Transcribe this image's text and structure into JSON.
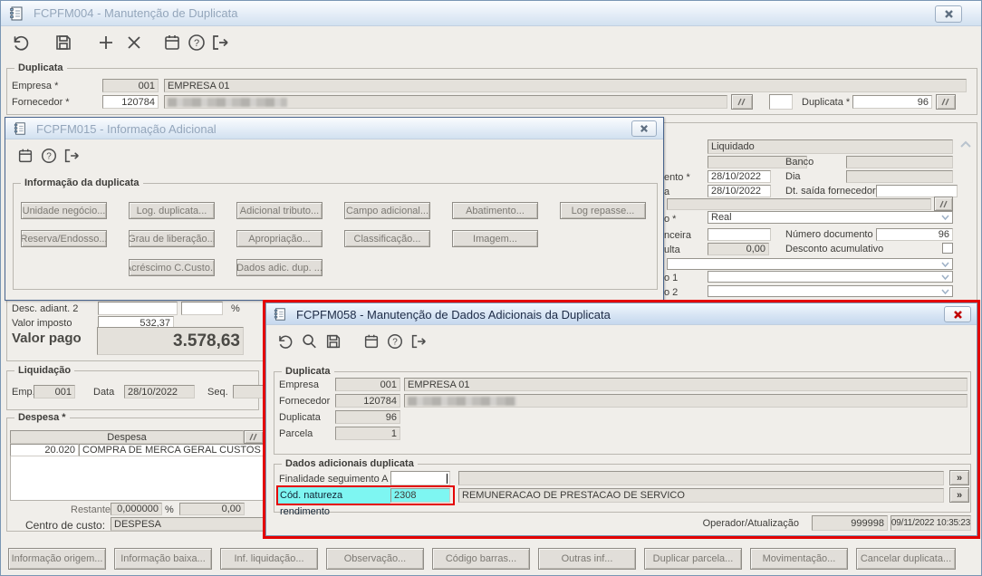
{
  "colors": {
    "highlight_red": "#e40000",
    "highlight_cyan": "#7ef6f2",
    "active_title_text": "#1d2b46",
    "inactive_title_text": "#94a6bb"
  },
  "fcpfm004": {
    "title": "FCPFM004 - Manutenção de Duplicata",
    "toolbar_icons": [
      "undo",
      "save",
      "add",
      "delete",
      "calendar",
      "help",
      "exit"
    ],
    "duplicata_group": {
      "label": "Duplicata",
      "empresa_label": "Empresa *",
      "empresa_code": "001",
      "empresa_name": "EMPRESA 01",
      "fornecedor_label": "Fornecedor *",
      "fornecedor_code": "120784",
      "duplicata_label": "Duplicata *",
      "duplicata_value": "96"
    },
    "right_fields": {
      "liquidado": "Liquidado",
      "banco_label": "Banco",
      "dia_label": "Dia",
      "vencimento_fragment": "ento *",
      "vencimento_value": "28/10/2022",
      "data_fragment": "a",
      "data_value": "28/10/2022",
      "dt_saida_label": "Dt. saída fornecedor",
      "moeda_fragment": "o *",
      "moeda_value": "Real",
      "financeira_fragment": "nceira",
      "numero_documento_label": "Número documento",
      "numero_documento_value": "96",
      "multa_fragment": "ulta",
      "multa_value": "0,00",
      "desconto_label": "Desconto acumulativo",
      "tipo1_fragment": "o 1",
      "tipo2_fragment": "o 2"
    },
    "valores": {
      "desc_adiant2_label": "Desc. adiant. 2",
      "percent_sign": "%",
      "valor_imposto_label": "Valor imposto",
      "valor_imposto_value": "532,37",
      "valor_pago_label": "Valor pago",
      "valor_pago_value": "3.578,63"
    },
    "liquidacao": {
      "label": "Liquidação",
      "emp_label": "Emp.",
      "emp_value": "001",
      "data_label": "Data",
      "data_value": "28/10/2022",
      "seq_label": "Seq."
    },
    "despesa": {
      "label": "Despesa *",
      "header": "Despesa",
      "row_code": "20.020",
      "row_desc": "COMPRA DE MERCA GERAL CUSTOS M",
      "restante_label": "Restante",
      "restante_pct": "0,000000",
      "percent_sign": "%",
      "restante_value": "0,00",
      "centro_label": "Centro de custo:",
      "centro_value": "DESPESA"
    },
    "bottom_buttons": [
      "Informação origem...",
      "Informação baixa...",
      "Inf. liquidação...",
      "Observação...",
      "Código barras...",
      "Outras inf...",
      "Duplicar parcela...",
      "Movimentação...",
      "Cancelar duplicata..."
    ]
  },
  "fcpfm015": {
    "title": "FCPFM015 - Informação Adicional",
    "toolbar_icons": [
      "calendar",
      "help",
      "exit"
    ],
    "group_label": "Informação da duplicata",
    "buttons_row1": [
      "Unidade negócio...",
      "Log. duplicata...",
      "Adicional tributo...",
      "Campo adicional...",
      "Abatimento...",
      "Log repasse..."
    ],
    "buttons_row2": [
      "Reserva/Endosso...",
      "Grau de liberação...",
      "Apropriação...",
      "Classificação...",
      "Imagem..."
    ],
    "buttons_row3": [
      "Acréscimo C.Custo...",
      "Dados adic. dup. ..."
    ]
  },
  "fcpfm058": {
    "title": "FCPFM058 - Manutenção de Dados Adicionais da Duplicata",
    "toolbar_icons": [
      "undo",
      "search",
      "save",
      "calendar",
      "help",
      "exit"
    ],
    "duplicata_group": {
      "label": "Duplicata",
      "empresa_label": "Empresa",
      "empresa_code": "001",
      "empresa_name": "EMPRESA 01",
      "fornecedor_label": "Fornecedor",
      "fornecedor_code": "120784",
      "duplicata_label": "Duplicata",
      "duplicata_value": "96",
      "parcela_label": "Parcela",
      "parcela_value": "1"
    },
    "dados_group": {
      "label": "Dados adicionais duplicata",
      "finalidade_label": "Finalidade seguimento A",
      "finalidade_value": "",
      "natureza_label": "Cód. natureza rendimento",
      "natureza_code": "2308",
      "natureza_desc": "REMUNERACAO DE PRESTACAO DE SERVICO",
      "more_symbol": "»"
    },
    "operador_label": "Operador/Atualização",
    "operador_value": "999998",
    "atualizacao_value": "09/11/2022 10:35:23"
  }
}
